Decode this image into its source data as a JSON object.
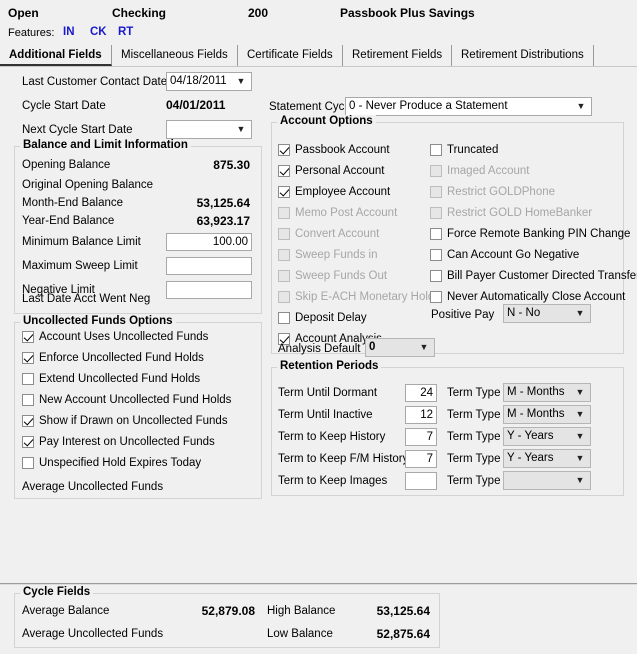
{
  "header": {
    "status": "Open",
    "account_type": "Checking",
    "account_number": "200",
    "product_name": "Passbook Plus Savings",
    "features_label": "Features:",
    "features": [
      "IN",
      "CK",
      "RT"
    ],
    "feature_color": "#1a1acc"
  },
  "tabs": [
    {
      "label": "Additional Fields",
      "active": true
    },
    {
      "label": "Miscellaneous Fields",
      "active": false
    },
    {
      "label": "Certificate Fields",
      "active": false
    },
    {
      "label": "Retirement Fields",
      "active": false
    },
    {
      "label": "Retirement Distributions",
      "active": false
    }
  ],
  "dates": {
    "last_contact_label": "Last Customer Contact Date",
    "last_contact_value": "04/18/2011",
    "cycle_start_label": "Cycle Start Date",
    "cycle_start_value": "04/01/2011",
    "next_cycle_label": "Next Cycle Start Date",
    "next_cycle_value": ""
  },
  "statement_cycle": {
    "label": "Statement Cycle",
    "value": "0 - Never Produce a Statement"
  },
  "balance_group": {
    "title": "Balance and Limit Information",
    "rows": [
      {
        "label": "Opening Balance",
        "value": "875.30"
      },
      {
        "label": "Original Opening Balance",
        "value": ""
      },
      {
        "label": "Month-End Balance",
        "value": "53,125.64"
      },
      {
        "label": "Year-End Balance",
        "value": "63,923.17"
      }
    ],
    "inputs": [
      {
        "label": "Minimum Balance Limit",
        "value": "100.00"
      },
      {
        "label": "Maximum Sweep Limit",
        "value": ""
      },
      {
        "label": "Negative Limit",
        "value": ""
      }
    ],
    "last_neg_label": "Last Date Acct Went Neg",
    "last_neg_value": ""
  },
  "uncollected_group": {
    "title": "Uncollected Funds Options",
    "items": [
      {
        "label": "Account Uses Uncollected Funds",
        "checked": true,
        "disabled": false
      },
      {
        "label": "Enforce Uncollected Fund Holds",
        "checked": true,
        "disabled": false
      },
      {
        "label": "Extend Uncollected Fund Holds",
        "checked": false,
        "disabled": false
      },
      {
        "label": "New Account Uncollected Fund Holds",
        "checked": false,
        "disabled": false
      },
      {
        "label": "Show if Drawn on Uncollected Funds",
        "checked": true,
        "disabled": false
      },
      {
        "label": "Pay Interest on Uncollected Funds",
        "checked": true,
        "disabled": false
      },
      {
        "label": "Unspecified Hold Expires Today",
        "checked": false,
        "disabled": false
      }
    ],
    "footer_label": "Average Uncollected Funds",
    "footer_value": ""
  },
  "account_options": {
    "title": "Account Options",
    "left_items": [
      {
        "label": "Passbook Account",
        "checked": true,
        "disabled": false
      },
      {
        "label": "Personal Account",
        "checked": true,
        "disabled": false
      },
      {
        "label": "Employee Account",
        "checked": true,
        "disabled": false
      },
      {
        "label": "Memo Post Account",
        "checked": false,
        "disabled": true
      },
      {
        "label": "Convert Account",
        "checked": false,
        "disabled": true
      },
      {
        "label": "Sweep Funds in",
        "checked": false,
        "disabled": true
      },
      {
        "label": "Sweep Funds Out",
        "checked": false,
        "disabled": true
      },
      {
        "label": "Skip E-ACH Monetary Holds",
        "checked": false,
        "disabled": true
      },
      {
        "label": "Deposit Delay",
        "checked": false,
        "disabled": false
      },
      {
        "label": "Account Analysis",
        "checked": true,
        "disabled": false
      }
    ],
    "right_items": [
      {
        "label": "Truncated",
        "checked": false,
        "disabled": false
      },
      {
        "label": "Imaged Account",
        "checked": false,
        "disabled": true
      },
      {
        "label": "Restrict GOLDPhone",
        "checked": false,
        "disabled": true
      },
      {
        "label": "Restrict GOLD HomeBanker",
        "checked": false,
        "disabled": true
      },
      {
        "label": "Force Remote Banking PIN Change",
        "checked": false,
        "disabled": false
      },
      {
        "label": "Can Account Go Negative",
        "checked": false,
        "disabled": false
      },
      {
        "label": "Bill Payer Customer Directed Transfers",
        "checked": false,
        "disabled": false
      },
      {
        "label": "Never Automatically Close Account",
        "checked": false,
        "disabled": false
      }
    ],
    "analysis_default_label": "Analysis Default",
    "analysis_default_value": "0",
    "positive_pay_label": "Positive Pay",
    "positive_pay_value": "N - No"
  },
  "retention": {
    "title": "Retention Periods",
    "term_type_label": "Term Type",
    "rows": [
      {
        "label": "Term Until Dormant",
        "value": "24",
        "term_type": "M - Months",
        "term_type_dim": true
      },
      {
        "label": "Term Until Inactive",
        "value": "12",
        "term_type": "M - Months",
        "term_type_dim": true
      },
      {
        "label": "Term to Keep History",
        "value": "7",
        "term_type": "Y - Years",
        "term_type_dim": true
      },
      {
        "label": "Term to Keep F/M History",
        "value": "7",
        "term_type": "Y - Years",
        "term_type_dim": true
      },
      {
        "label": "Term to Keep Images",
        "value": "",
        "term_type": "",
        "term_type_dim": true
      }
    ]
  },
  "cycle_fields": {
    "title": "Cycle Fields",
    "rows": [
      {
        "label": "Average Balance",
        "value": "52,879.08",
        "label2": "High Balance",
        "value2": "53,125.64"
      },
      {
        "label": "Average Uncollected Funds",
        "value": "",
        "label2": "Low Balance",
        "value2": "52,875.64"
      }
    ]
  },
  "icons": {
    "chevron_down": "⌄"
  }
}
